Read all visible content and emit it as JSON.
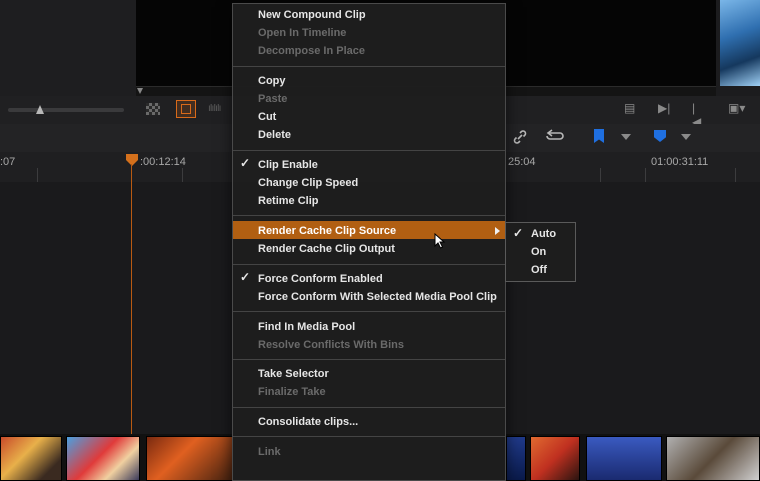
{
  "timeline": {
    "timecodes": [
      {
        "label": ":07"
      },
      {
        "label": ":00:12:14"
      },
      {
        "label": "25:04"
      },
      {
        "label": "01:00:31:11"
      }
    ]
  },
  "icons": {
    "link": "link-icon",
    "loop": "loop-icon",
    "flag": "flag-icon",
    "marker": "marker-icon",
    "checker": "checkerboard-icon",
    "film": "film-icon",
    "audio": "audio-waveform-icon"
  },
  "context_menu": {
    "items": [
      {
        "label": "New Compound Clip",
        "enabled": true
      },
      {
        "label": "Open In Timeline",
        "enabled": false
      },
      {
        "label": "Decompose In Place",
        "enabled": false
      },
      {
        "label": "Copy",
        "enabled": true
      },
      {
        "label": "Paste",
        "enabled": false
      },
      {
        "label": "Cut",
        "enabled": true
      },
      {
        "label": "Delete",
        "enabled": true
      },
      {
        "label": "Clip Enable",
        "enabled": true,
        "checked": true
      },
      {
        "label": "Change Clip Speed",
        "enabled": true
      },
      {
        "label": "Retime Clip",
        "enabled": true
      },
      {
        "label": "Render Cache Clip Source",
        "enabled": true,
        "highlighted": true,
        "submenu": true
      },
      {
        "label": "Render Cache Clip Output",
        "enabled": true
      },
      {
        "label": "Force Conform Enabled",
        "enabled": true,
        "checked": true
      },
      {
        "label": "Force Conform With Selected Media Pool Clip",
        "enabled": true
      },
      {
        "label": "Find In Media Pool",
        "enabled": true
      },
      {
        "label": "Resolve Conflicts With Bins",
        "enabled": false
      },
      {
        "label": "Take Selector",
        "enabled": true
      },
      {
        "label": "Finalize Take",
        "enabled": false
      },
      {
        "label": "Consolidate clips...",
        "enabled": true
      },
      {
        "label": "Link",
        "enabled": false
      }
    ],
    "check_glyph": "✓"
  },
  "submenu": {
    "items": [
      {
        "label": "Auto",
        "checked": true
      },
      {
        "label": "On",
        "checked": false
      },
      {
        "label": "Off",
        "checked": false
      }
    ]
  },
  "colors": {
    "highlight": "#b15f12",
    "playhead": "#d4701c",
    "flag_blue": "#1f6fe0"
  }
}
